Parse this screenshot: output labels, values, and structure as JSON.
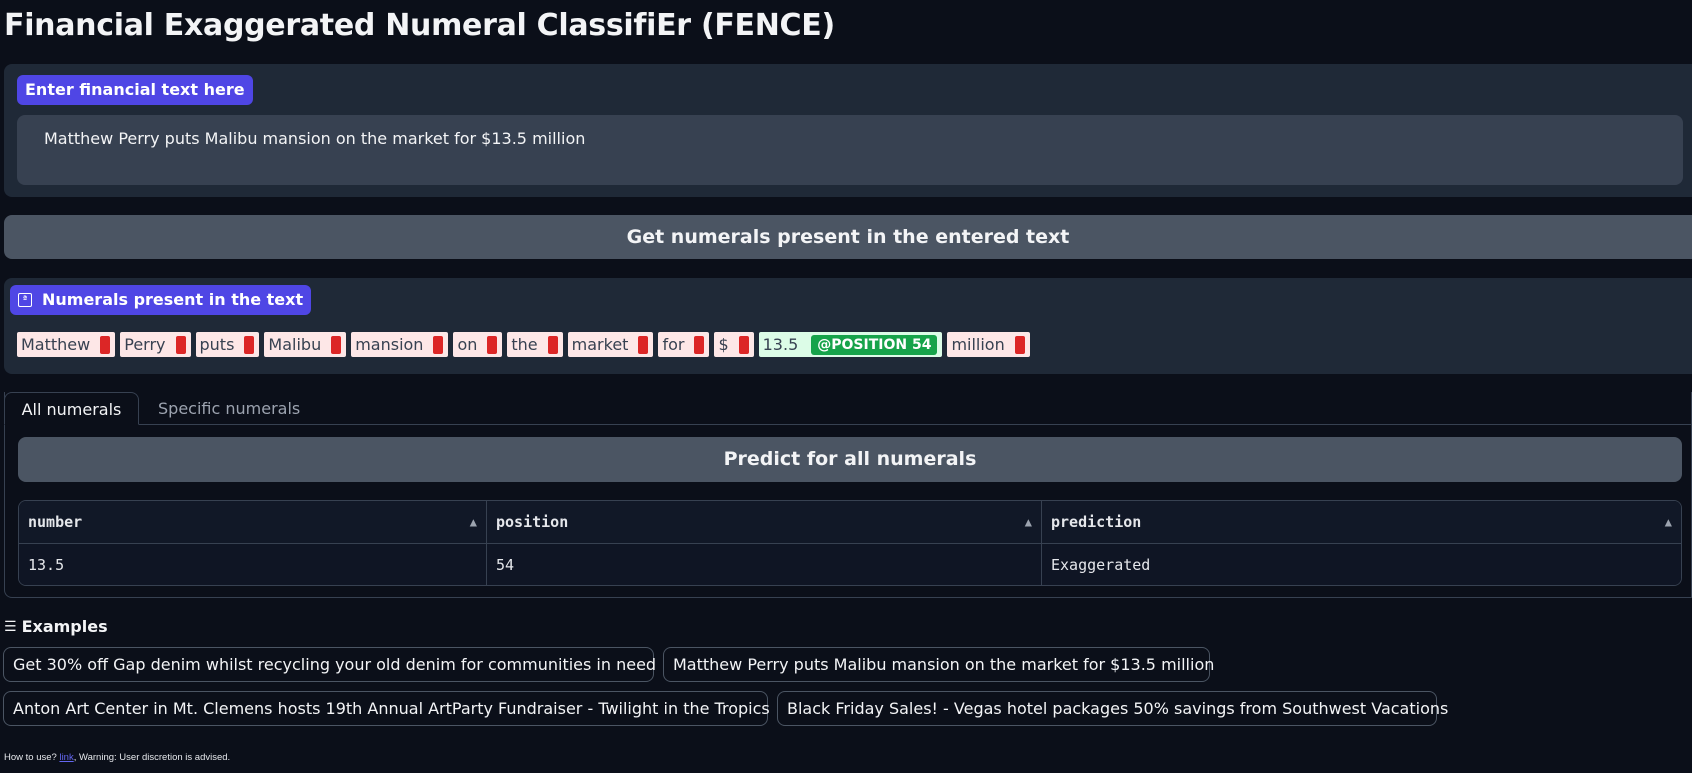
{
  "app": {
    "title": "Financial Exaggerated Numeral ClassifiEr (FENCE)"
  },
  "input": {
    "label": "Enter financial text here",
    "value": "Matthew Perry puts Malibu mansion on the market for $13.5 million"
  },
  "get_button": {
    "label": "Get numerals present in the entered text"
  },
  "highlight": {
    "label": "Numerals present in the text",
    "tokens": [
      {
        "text": "Matthew",
        "type": "other"
      },
      {
        "text": "Perry",
        "type": "other"
      },
      {
        "text": "puts",
        "type": "other"
      },
      {
        "text": "Malibu",
        "type": "other"
      },
      {
        "text": "mansion",
        "type": "other"
      },
      {
        "text": "on",
        "type": "other"
      },
      {
        "text": "the",
        "type": "other"
      },
      {
        "text": "market",
        "type": "other"
      },
      {
        "text": "for",
        "type": "other"
      },
      {
        "text": "$",
        "type": "other"
      },
      {
        "text": "13.5",
        "type": "numeral",
        "badge": "@POSITION 54"
      },
      {
        "text": "million",
        "type": "other"
      }
    ],
    "colors": {
      "other_bg": "#fde7e7",
      "other_mark": "#dc2626",
      "numeral_bg": "#dcfce7",
      "numeral_badge": "#16a34a"
    }
  },
  "tabs": [
    {
      "label": "All numerals",
      "active": true
    },
    {
      "label": "Specific numerals",
      "active": false
    }
  ],
  "predict_button": {
    "label": "Predict for all numerals"
  },
  "table": {
    "headers": [
      "number",
      "position",
      "prediction"
    ],
    "rows": [
      [
        "13.5",
        "54",
        "Exaggerated"
      ]
    ]
  },
  "examples": {
    "title": "Examples",
    "items": [
      "Get 30% off Gap denim whilst recycling your old denim for communities in need",
      "Matthew Perry puts Malibu mansion on the market for $13.5 million",
      "Anton Art Center in Mt. Clemens hosts 19th Annual ArtParty Fundraiser - Twilight in the Tropics",
      "Black Friday Sales! - Vegas hotel packages 50% savings from Southwest Vacations"
    ]
  },
  "footer": {
    "prefix": "How to use? ",
    "link": "link",
    "suffix": ", Warning: User discretion is advised."
  },
  "theme": {
    "accent": "#4f46e5",
    "background": "#0b0f19",
    "panel": "#1f2937",
    "button": "#4b5563"
  }
}
